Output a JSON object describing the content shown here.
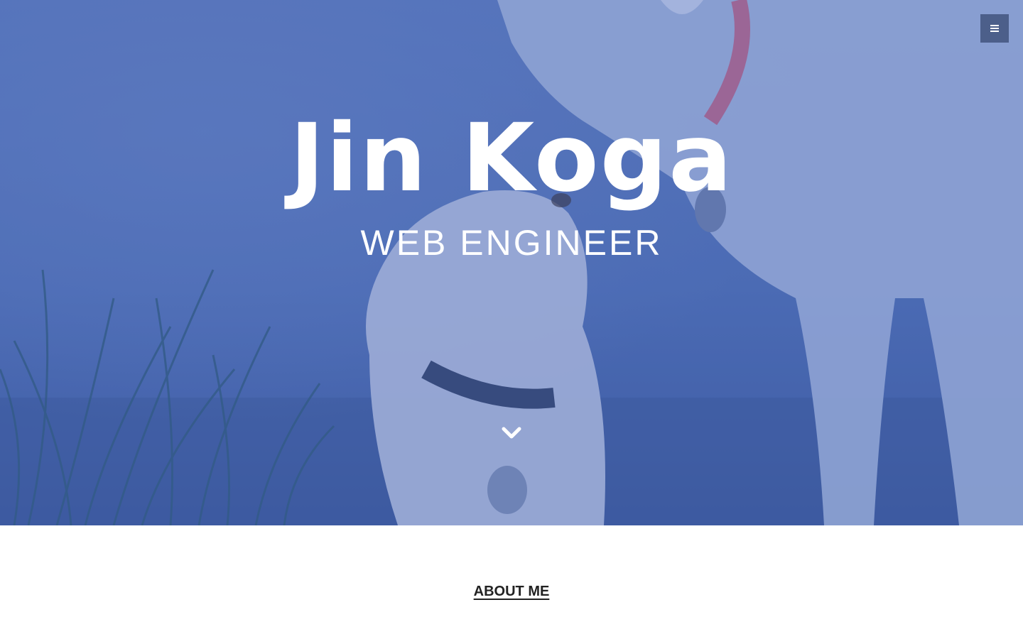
{
  "hero": {
    "name": "Jin Koga",
    "role": "WEB ENGINEER",
    "overlay_color": "#3f5fae",
    "background_image": "two-dogs-nuzzling-photo"
  },
  "nav": {
    "menu_icon": "hamburger-menu-icon"
  },
  "scroll": {
    "icon": "chevron-down-icon"
  },
  "sections": {
    "about_label": "ABOUT ME"
  },
  "colors": {
    "text_light": "#ffffff",
    "text_dark": "#222222",
    "menu_bg": "#465882"
  }
}
